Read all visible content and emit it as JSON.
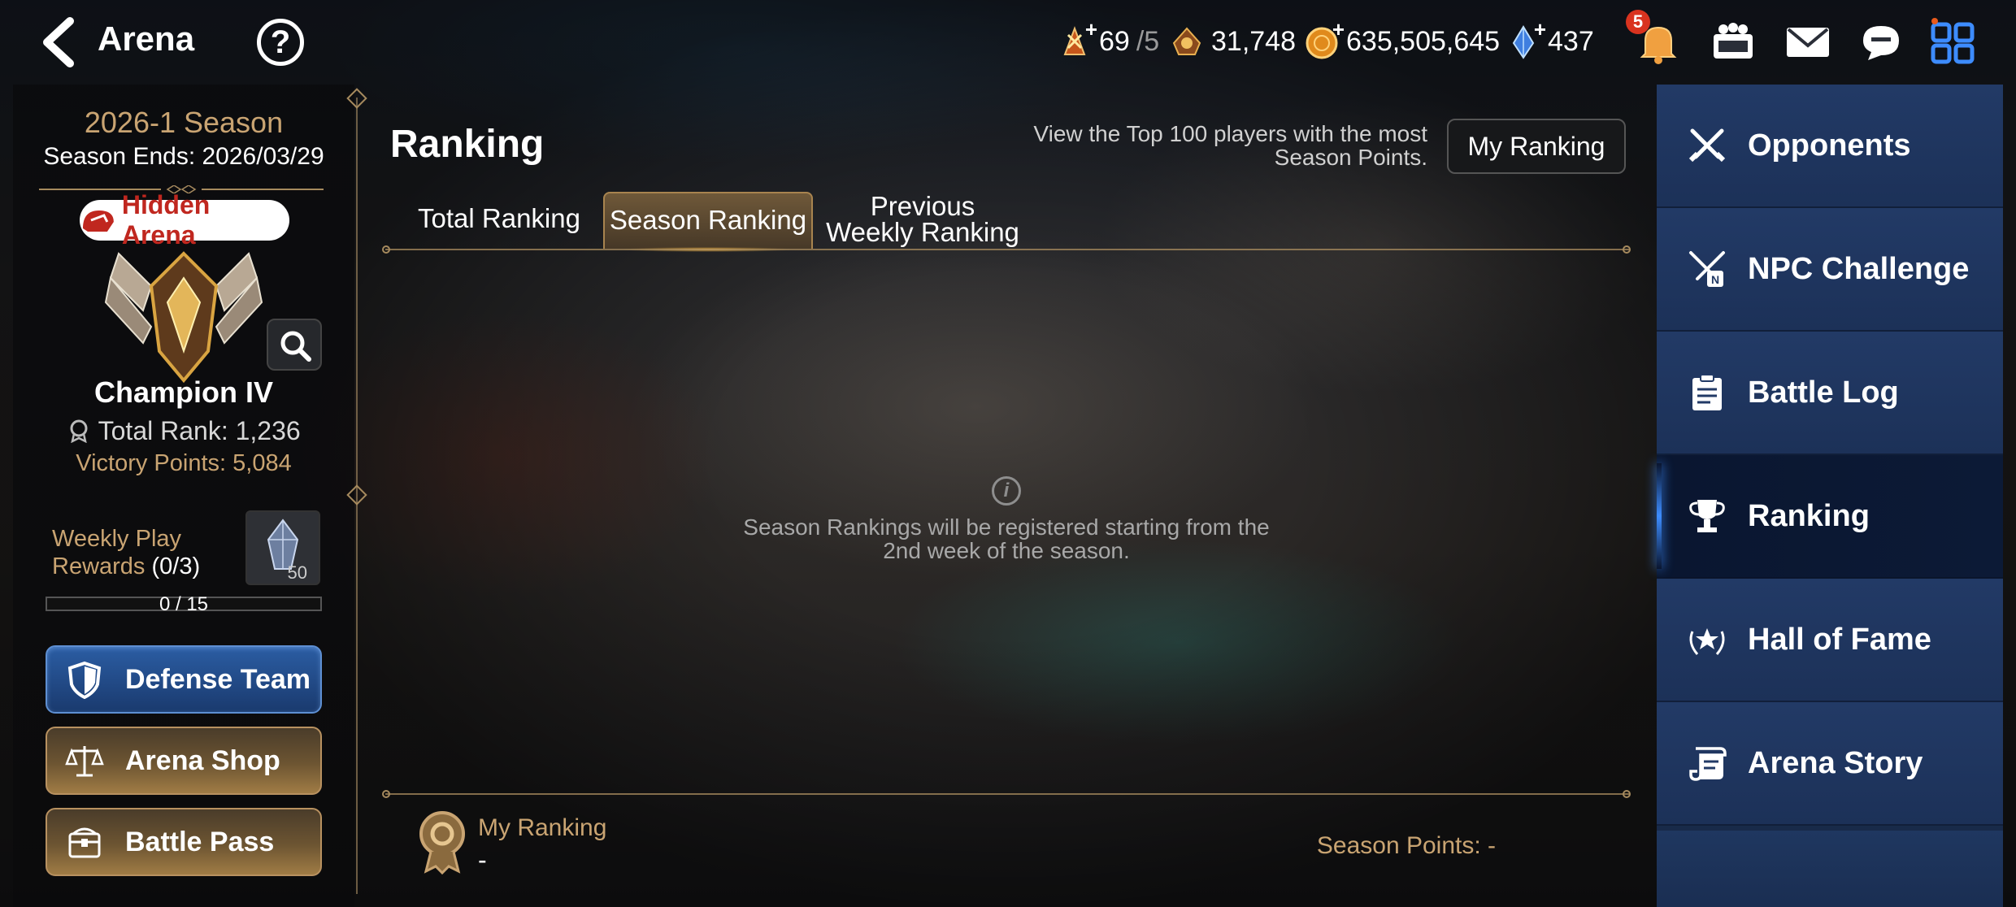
{
  "header": {
    "title": "Arena",
    "currencies": {
      "stamina_value": "69",
      "stamina_max": "/5",
      "points": "31,748",
      "gold": "635,505,645",
      "crystals": "437"
    },
    "notification_count": "5"
  },
  "season": {
    "title": "2026-1 Season",
    "ends": "Season Ends: 2026/03/29",
    "hidden_arena_label": "Hidden Arena",
    "tier": "Champion IV",
    "total_rank": "Total Rank: 1,236",
    "victory_points": "Victory Points: 5,084",
    "weekly_label_line1": "Weekly Play",
    "weekly_label_line2": "Rewards",
    "weekly_count": "(0/3)",
    "reward_qty": "50",
    "progress_text": "0 / 15",
    "progress_fraction": 0
  },
  "buttons": {
    "defense_team": "Defense Team",
    "arena_shop": "Arena Shop",
    "battle_pass": "Battle Pass"
  },
  "ranking": {
    "title": "Ranking",
    "desc_line1": "View the Top 100 players with the most",
    "desc_line2": "Season Points.",
    "my_ranking_button": "My Ranking",
    "tabs": {
      "total": "Total Ranking",
      "season": "Season Ranking",
      "prev_line1": "Previous",
      "prev_line2": "Weekly Ranking"
    },
    "empty_line1": "Season Rankings will be registered starting from the",
    "empty_line2": "2nd week of the season.",
    "my_ranking_label": "My Ranking",
    "my_ranking_value": "-",
    "season_points": "Season Points: -"
  },
  "menu": {
    "opponents": "Opponents",
    "npc_challenge": "NPC Challenge",
    "battle_log": "Battle Log",
    "ranking": "Ranking",
    "hall_of_fame": "Hall of Fame",
    "arena_story": "Arena Story"
  },
  "colors": {
    "gold_text": "#c9a472",
    "menu_bg": "#223a66",
    "active_menu": "#0a1630",
    "accent_blue": "#3d8cff"
  }
}
